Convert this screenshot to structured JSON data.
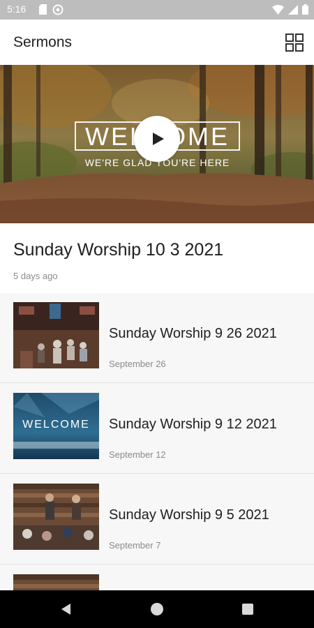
{
  "status_bar": {
    "time": "5:16",
    "icons": [
      "sd-card-icon",
      "sync-icon",
      "wifi-icon",
      "signal-icon",
      "battery-icon"
    ]
  },
  "app_bar": {
    "title": "Sermons",
    "grid_icon": "grid-view-icon"
  },
  "hero": {
    "welcome_text": "WELCOME",
    "subtitle": "WE'RE GLAD YOU'RE HERE",
    "play_icon": "play-icon"
  },
  "featured": {
    "title": "Sunday Worship 10 3 2021",
    "date": "5 days ago"
  },
  "sermons": [
    {
      "title": "Sunday Worship 9 26 2021",
      "date": "September 26"
    },
    {
      "title": "Sunday Worship 9 12 2021",
      "date": "September 12",
      "thumb_text": "WELCOME"
    },
    {
      "title": "Sunday Worship 9 5 2021",
      "date": "September 7"
    }
  ],
  "nav_bar": {
    "icons": [
      "back-icon",
      "home-icon",
      "recents-icon"
    ]
  },
  "colors": {
    "status_bar": "#bdbdbd",
    "list_background": "#f7f7f7",
    "secondary_text": "#8a8a8a",
    "primary_text": "#202020"
  }
}
